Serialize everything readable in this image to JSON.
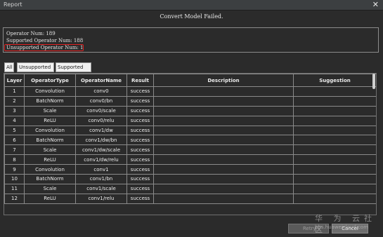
{
  "window": {
    "title": "Report",
    "close_glyph": "✕"
  },
  "headline": "Convert Model Failed.",
  "summary": {
    "operator_num": "Operator Num: 189",
    "supported_num": "Supported Operator Num: 188",
    "unsupported_num": "Unsupported Operator Num: 1",
    "highlight_color": "#e02020"
  },
  "tabs": [
    {
      "label": "All"
    },
    {
      "label": "Unsupported"
    },
    {
      "label": "Supported"
    }
  ],
  "table": {
    "headers": [
      "Layer",
      "OperatorType",
      "OperatorName",
      "Result",
      "Description",
      "Suggestion"
    ],
    "rows": [
      [
        "1",
        "Convolution",
        "conv0",
        "success",
        "",
        ""
      ],
      [
        "2",
        "BatchNorm",
        "conv0/bn",
        "success",
        "",
        ""
      ],
      [
        "3",
        "Scale",
        "conv0/scale",
        "success",
        "",
        ""
      ],
      [
        "4",
        "ReLU",
        "conv0/relu",
        "success",
        "",
        ""
      ],
      [
        "5",
        "Convolution",
        "conv1/dw",
        "success",
        "",
        ""
      ],
      [
        "6",
        "BatchNorm",
        "conv1/dw/bn",
        "success",
        "",
        ""
      ],
      [
        "7",
        "Scale",
        "conv1/dw/scale",
        "success",
        "",
        ""
      ],
      [
        "8",
        "ReLU",
        "conv1/dw/relu",
        "success",
        "",
        ""
      ],
      [
        "9",
        "Convolution",
        "conv1",
        "success",
        "",
        ""
      ],
      [
        "10",
        "BatchNorm",
        "conv1/bn",
        "success",
        "",
        ""
      ],
      [
        "11",
        "Scale",
        "conv1/scale",
        "success",
        "",
        ""
      ],
      [
        "12",
        "ReLU",
        "conv1/relu",
        "success",
        "",
        ""
      ]
    ]
  },
  "buttons": {
    "retry": "Retry",
    "cancel": "Cancel"
  },
  "watermark": {
    "line1": "华 为 云社区",
    "line2": "bbs.huaweicloud.com"
  }
}
